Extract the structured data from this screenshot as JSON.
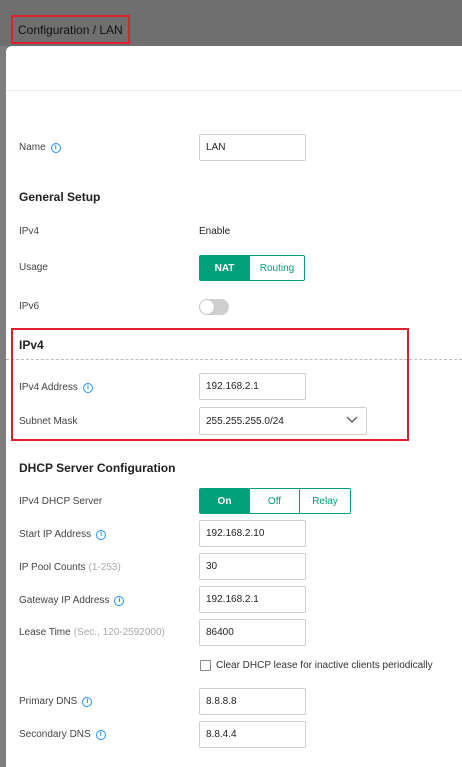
{
  "breadcrumb": "Configuration / LAN",
  "name_field": {
    "label": "Name",
    "value": "LAN"
  },
  "general_setup": {
    "title": "General Setup",
    "ipv4_label": "IPv4",
    "ipv4_value": "Enable",
    "usage_label": "Usage",
    "usage_options": [
      "NAT",
      "Routing"
    ],
    "usage_selected": "NAT",
    "ipv6_label": "IPv6",
    "ipv6_enabled": false
  },
  "ipv4": {
    "title": "IPv4",
    "address_label": "IPv4 Address",
    "address_value": "192.168.2.1",
    "subnet_label": "Subnet Mask",
    "subnet_value": "255.255.255.0/24"
  },
  "dhcp": {
    "title": "DHCP Server Configuration",
    "server_label": "IPv4 DHCP Server",
    "server_options": [
      "On",
      "Off",
      "Relay"
    ],
    "server_selected": "On",
    "start_ip_label": "Start IP Address",
    "start_ip_value": "192.168.2.10",
    "pool_label": "IP Pool Counts",
    "pool_hint": "(1-253)",
    "pool_value": "30",
    "gateway_label": "Gateway IP Address",
    "gateway_value": "192.168.2.1",
    "lease_label": "Lease Time",
    "lease_hint": "(Sec., 120-2592000)",
    "lease_value": "86400",
    "clear_lease_label": "Clear DHCP lease for inactive clients periodically",
    "clear_lease_checked": false,
    "primary_dns_label": "Primary DNS",
    "primary_dns_value": "8.8.8.8",
    "secondary_dns_label": "Secondary DNS",
    "secondary_dns_value": "8.8.4.4"
  },
  "colors": {
    "accent": "#00a07a",
    "highlight": "#e0202f",
    "info": "#1e90ff"
  }
}
